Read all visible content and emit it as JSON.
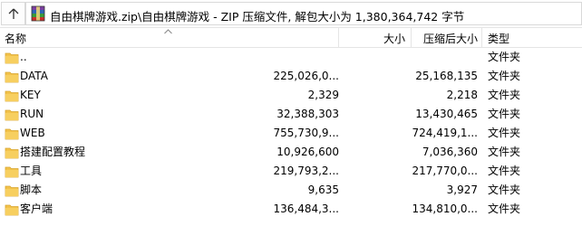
{
  "address": {
    "path": "自由棋牌游戏.zip\\自由棋牌游戏 - ZIP 压缩文件, 解包大小为 1,380,364,742 字节"
  },
  "columns": {
    "name": "名称",
    "size": "大小",
    "packed": "压缩后大小",
    "type": "类型"
  },
  "rows": [
    {
      "name": "..",
      "size": "",
      "packed": "",
      "type": "文件夹"
    },
    {
      "name": "DATA",
      "size": "225,026,0...",
      "packed": "25,168,135",
      "type": "文件夹"
    },
    {
      "name": "KEY",
      "size": "2,329",
      "packed": "2,218",
      "type": "文件夹"
    },
    {
      "name": "RUN",
      "size": "32,388,303",
      "packed": "13,430,465",
      "type": "文件夹"
    },
    {
      "name": "WEB",
      "size": "755,730,9...",
      "packed": "724,419,1...",
      "type": "文件夹"
    },
    {
      "name": "搭建配置教程",
      "size": "10,926,600",
      "packed": "7,036,360",
      "type": "文件夹"
    },
    {
      "name": "工具",
      "size": "219,793,2...",
      "packed": "217,770,0...",
      "type": "文件夹"
    },
    {
      "name": "脚本",
      "size": "9,635",
      "packed": "3,927",
      "type": "文件夹"
    },
    {
      "name": "客户端",
      "size": "136,484,3...",
      "packed": "134,810,0...",
      "type": "文件夹"
    }
  ],
  "colors": {
    "folder": "#f2c24b",
    "folder_dark": "#d9a52e",
    "border": "#d9d9d9"
  }
}
